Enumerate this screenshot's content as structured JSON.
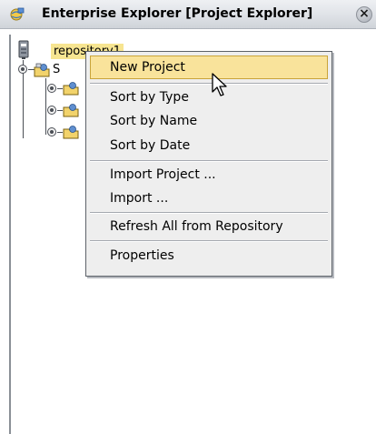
{
  "window": {
    "title": "Enterprise Explorer [Project Explorer]",
    "close_glyph": "×"
  },
  "tree": {
    "root_label": "repository1",
    "child_partial": "S"
  },
  "context_menu": {
    "items": [
      "New Project",
      "Sort by Type",
      "Sort by Name",
      "Sort by Date",
      "Import Project ...",
      "Import ...",
      "Refresh All from Repository",
      "Properties"
    ],
    "highlighted": "New Project"
  },
  "colors": {
    "selection_highlight": "#f9e39b",
    "menu_background": "#eeeeee",
    "title_gradient_top": "#eef0f3"
  },
  "icons": {
    "title": "globe-folder-icon",
    "root": "repository-server-icon",
    "project": "project-folder-icon",
    "close": "close-icon",
    "cursor": "arrow-pointer-icon"
  }
}
